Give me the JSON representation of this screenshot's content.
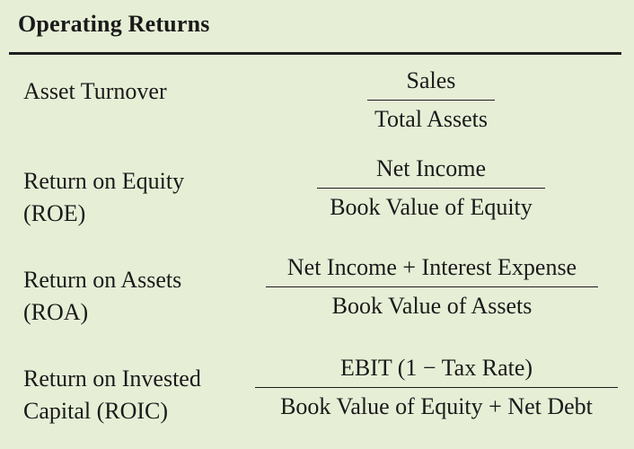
{
  "title": "Operating Returns",
  "rows": [
    {
      "label_line1": "Asset Turnover",
      "label_line2": "",
      "numerator": "Sales",
      "denominator": "Total Assets"
    },
    {
      "label_line1": "Return on Equity",
      "label_line2": "(ROE)",
      "numerator": "Net Income",
      "denominator": "Book Value of Equity"
    },
    {
      "label_line1": "Return on Assets",
      "label_line2": "(ROA)",
      "numerator": "Net Income + Interest Expense",
      "denominator": "Book Value of Assets"
    },
    {
      "label_line1": "Return on Invested",
      "label_line2": "Capital (ROIC)",
      "numerator": "EBIT (1 − Tax Rate)",
      "denominator": "Book Value of Equity + Net Debt"
    }
  ]
}
